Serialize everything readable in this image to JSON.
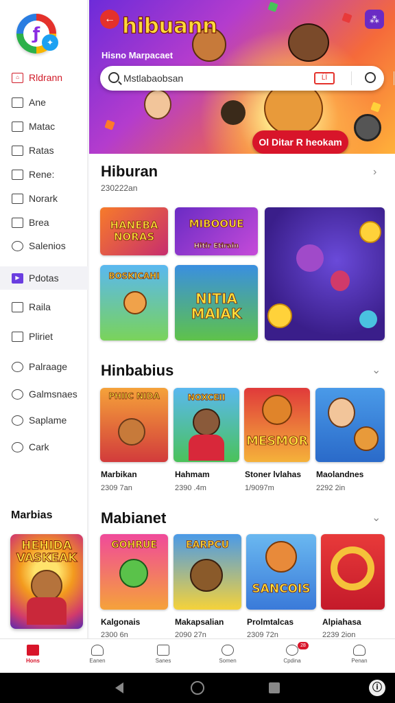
{
  "sidebar": {
    "items": [
      {
        "label": "Rldrann",
        "icon": "home-icon"
      },
      {
        "label": "Ane",
        "icon": "grid-icon"
      },
      {
        "label": "Matac",
        "icon": "card-icon"
      },
      {
        "label": "Ratas",
        "icon": "tag-icon"
      },
      {
        "label": "Rene:",
        "icon": "ticket-icon"
      },
      {
        "label": "Norark",
        "icon": "bookmark-icon"
      },
      {
        "label": "Brea",
        "icon": "box-icon"
      },
      {
        "label": "Salenios",
        "icon": "circle-icon"
      },
      {
        "label": "Pdotas",
        "icon": "play-icon"
      },
      {
        "label": "Raila",
        "icon": "edit-icon"
      },
      {
        "label": "Pliriet",
        "icon": "document-icon"
      },
      {
        "label": "Palraage",
        "icon": "chat-icon"
      },
      {
        "label": "Galmsnaes",
        "icon": "chat-bubble-icon"
      },
      {
        "label": "Saplame",
        "icon": "gear-icon"
      },
      {
        "label": "Cark",
        "icon": "hand-icon"
      }
    ],
    "promo_title": "Marbias",
    "promo_tile_text": "HEHIDA VASKEAK"
  },
  "hero": {
    "title": "hibuann",
    "subtitle": "Hisno Marpacaet",
    "search_placeholder": "Mstlabaobsan",
    "camera_label": "ĹÏ",
    "cta": "Ol Ditar R heokam"
  },
  "section1": {
    "title": "Hiburan",
    "subtitle": "230222an",
    "tiles": [
      "HANEBA NORAS",
      "MIBOOUE",
      "BOSKICAHI",
      "NITIA MAIAK"
    ],
    "tile_badge": "Hitir Etirain"
  },
  "section2": {
    "title": "Hinbabius",
    "games": [
      {
        "name": "Marbikan",
        "sub": "2309 7an",
        "art": "PHIIC NIDA"
      },
      {
        "name": "Hahmam",
        "sub": "2390 .4m",
        "art": "NOXCEII"
      },
      {
        "name": "Stoner lvlahas",
        "sub": "1/9097m",
        "art": "MESMOR"
      },
      {
        "name": "Maolandnes",
        "sub": "2292 2in",
        "art": ""
      }
    ]
  },
  "section3": {
    "title": "Mabianet",
    "games": [
      {
        "name": "Kalgonais",
        "sub": "2300 6n",
        "art": "GOHRUE"
      },
      {
        "name": "Makapsalian",
        "sub": "2090 27n",
        "art": "EARPCU"
      },
      {
        "name": "Prolmtalcas",
        "sub": "2309 72n",
        "art": "SANCOIS"
      },
      {
        "name": "Alpiahasa",
        "sub": "2239 2ion",
        "art": ""
      }
    ]
  },
  "bottom_nav": [
    {
      "label": "Hons",
      "icon": "home-icon"
    },
    {
      "label": "Eanen",
      "icon": "bell-icon"
    },
    {
      "label": "Sanes",
      "icon": "tv-icon"
    },
    {
      "label": "Somen",
      "icon": "gamepad-icon"
    },
    {
      "label": "Cpdina",
      "icon": "compass-icon",
      "badge": "28"
    },
    {
      "label": "Penan",
      "icon": "person-icon"
    }
  ],
  "system_bar": {
    "accessibility": "ⓘ"
  },
  "colors": {
    "accent": "#d8152a",
    "purple": "#6a3ee0"
  }
}
